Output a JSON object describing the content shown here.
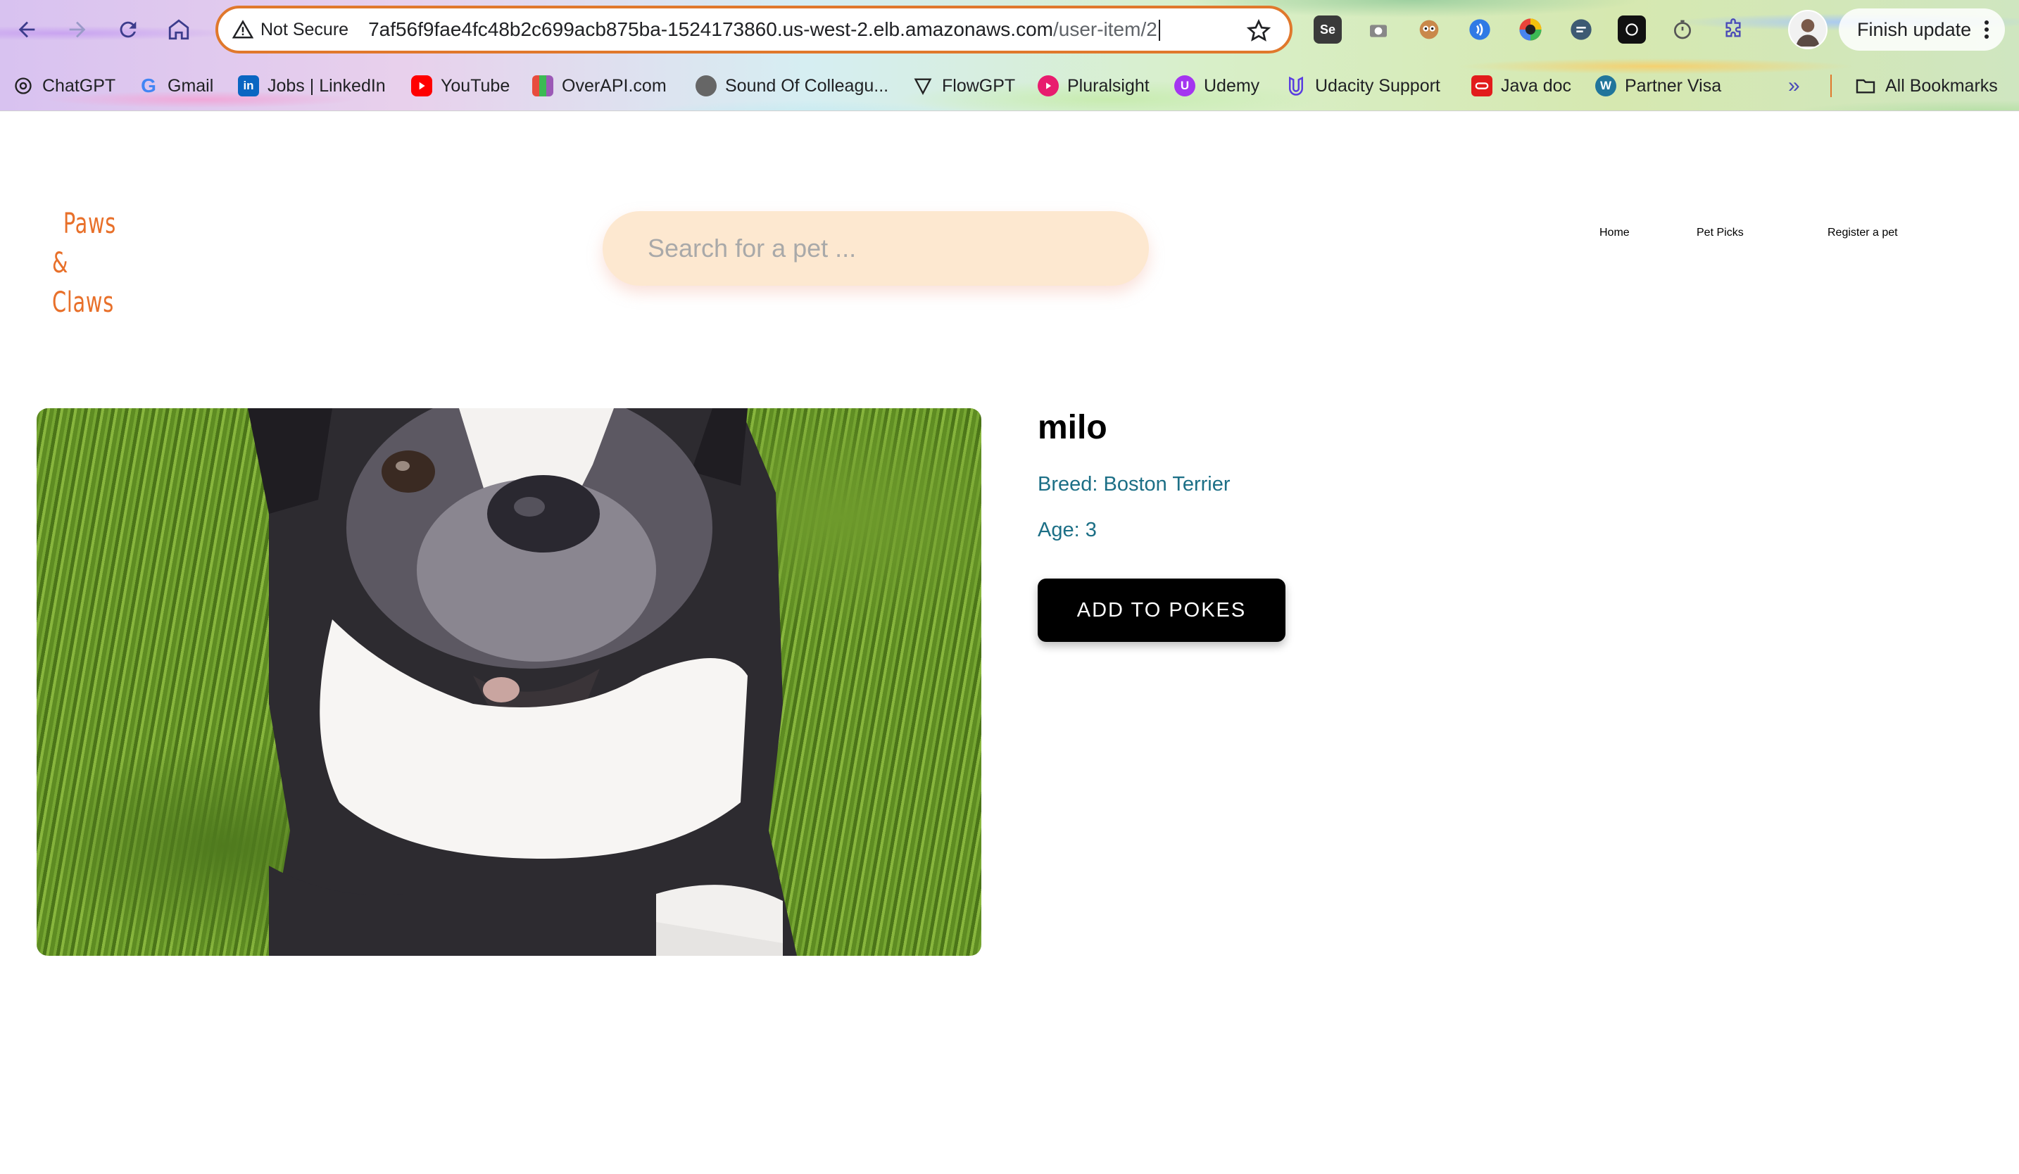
{
  "browser": {
    "security_label": "Not Secure",
    "url_host": "7af56f9fae4fc48b2c699acb875ba-1524173860.us-west-2.elb.amazonaws.com",
    "url_path": "/user-item/2",
    "finish_update_label": "Finish update",
    "bookmarks": [
      {
        "label": "ChatGPT",
        "icon": "chatgpt-icon"
      },
      {
        "label": "Gmail",
        "icon": "google-icon"
      },
      {
        "label": "Jobs | LinkedIn",
        "icon": "linkedin-icon"
      },
      {
        "label": "YouTube",
        "icon": "youtube-icon"
      },
      {
        "label": "OverAPI.com",
        "icon": "overapi-icon"
      },
      {
        "label": "Sound Of Colleagu...",
        "icon": "globe-icon"
      },
      {
        "label": "FlowGPT",
        "icon": "flowgpt-icon"
      },
      {
        "label": "Pluralsight",
        "icon": "pluralsight-icon"
      },
      {
        "label": "Udemy",
        "icon": "udemy-icon"
      },
      {
        "label": "Udacity Support",
        "icon": "udacity-icon"
      },
      {
        "label": "Java doc",
        "icon": "oracle-icon"
      },
      {
        "label": "Partner Visa",
        "icon": "wordpress-icon"
      }
    ],
    "all_bookmarks_label": "All Bookmarks"
  },
  "site": {
    "logo_line1": "Paws",
    "logo_line2": "& Claws",
    "search_placeholder": "Search for a pet ...",
    "nav": {
      "home": "Home",
      "pet_picks": "Pet Picks",
      "register": "Register a pet"
    }
  },
  "pet": {
    "name": "milo",
    "breed_text": "Breed: Boston Terrier",
    "age_text": "Age: 3",
    "add_button_label": "ADD TO POKES"
  }
}
